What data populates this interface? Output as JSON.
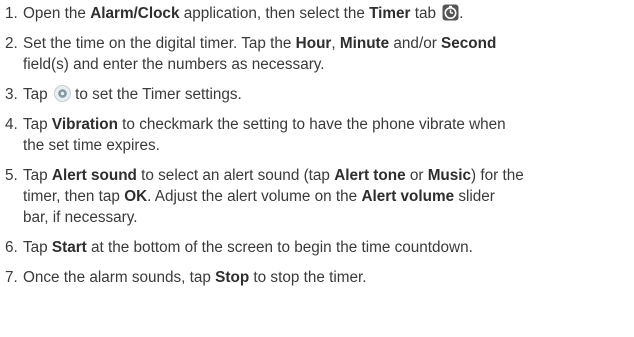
{
  "steps": [
    {
      "num": "1.",
      "lines": [
        [
          "Open the ",
          {
            "b": "Alarm/Clock"
          },
          " application, then select the ",
          {
            "b": "Timer"
          },
          " tab ",
          {
            "icon": "timer-tab-icon"
          },
          "."
        ]
      ]
    },
    {
      "num": "2.",
      "lines": [
        [
          "Set the time on the digital timer. Tap the ",
          {
            "b": "Hour"
          },
          ", ",
          {
            "b": "Minute"
          },
          " and/or ",
          {
            "b": "Second"
          }
        ],
        [
          "field(s) and enter the numbers as necessary."
        ]
      ]
    },
    {
      "num": "3.",
      "lines": [
        [
          "Tap ",
          {
            "icon": "settings-icon"
          },
          " to set the Timer settings."
        ]
      ]
    },
    {
      "num": "4.",
      "lines": [
        [
          "Tap ",
          {
            "b": "Vibration"
          },
          " to checkmark the setting to have the phone vibrate when"
        ],
        [
          "the set time expires."
        ]
      ]
    },
    {
      "num": "5.",
      "lines": [
        [
          "Tap ",
          {
            "b": "Alert sound"
          },
          " to select an alert sound (tap ",
          {
            "b": "Alert tone"
          },
          " or ",
          {
            "b": "Music"
          },
          ") for the"
        ],
        [
          "timer, then tap ",
          {
            "b": "OK"
          },
          ". Adjust the alert volume on the ",
          {
            "b": "Alert volume"
          },
          " slider"
        ],
        [
          "bar, if necessary."
        ]
      ]
    },
    {
      "num": "6.",
      "lines": [
        [
          "Tap ",
          {
            "b": "Start"
          },
          " at the bottom of the screen to begin the time countdown."
        ]
      ]
    },
    {
      "num": "7.",
      "lines": [
        [
          "Once the alarm sounds, tap ",
          {
            "b": "Stop"
          },
          " to stop the timer."
        ]
      ]
    }
  ]
}
